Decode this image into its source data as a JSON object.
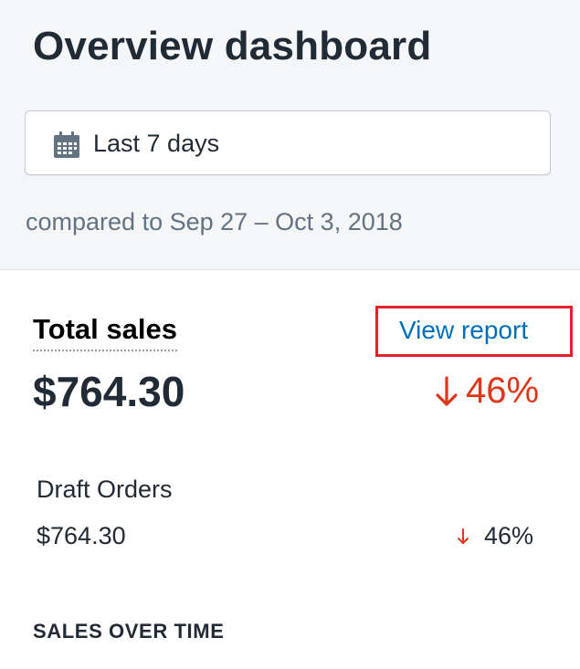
{
  "header": {
    "title": "Overview dashboard",
    "date_range": {
      "label": "Last 7 days",
      "icon": "calendar-icon"
    },
    "compared_to": "compared to Sep 27 – Oct 3, 2018"
  },
  "total_sales": {
    "title": "Total sales",
    "view_report_label": "View report",
    "value": "$764.30",
    "change": "46%",
    "change_direction": "down",
    "change_color": "#de3618",
    "breakdown": [
      {
        "label": "Draft Orders",
        "value": "$764.30",
        "change": "46%",
        "change_direction": "down"
      }
    ]
  },
  "sales_over_time": {
    "title": "SALES OVER TIME"
  },
  "colors": {
    "link": "#006fbb",
    "negative": "#de3618",
    "highlight": "#e5202c",
    "header_bg": "#f4f6f8"
  }
}
